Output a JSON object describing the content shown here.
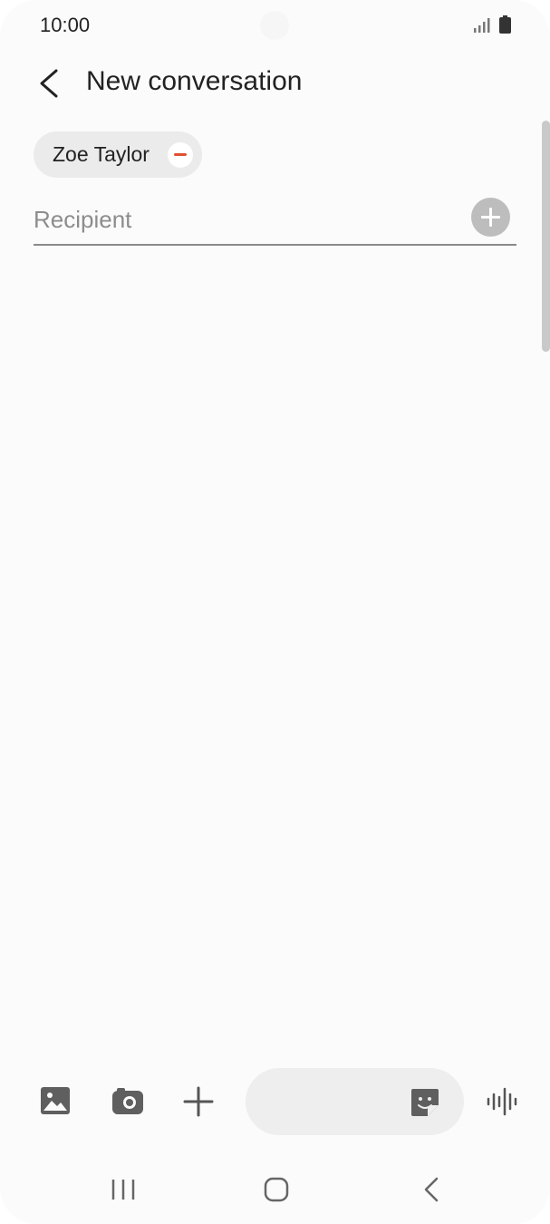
{
  "status_bar": {
    "time": "10:00",
    "signal_icon": "signal-icon",
    "battery_icon": "battery-icon"
  },
  "header": {
    "back_icon": "chevron-left-icon",
    "title": "New conversation"
  },
  "recipients": {
    "chips": [
      {
        "name": "Zoe Taylor",
        "remove_icon": "minus-circle-icon"
      }
    ],
    "input_placeholder": "Recipient",
    "input_value": "",
    "add_icon": "plus-circle-icon"
  },
  "composer": {
    "gallery_icon": "image-icon",
    "camera_icon": "camera-icon",
    "add_icon": "plus-icon",
    "message_value": "",
    "sticker_icon": "sticker-icon",
    "voice_icon": "voice-waveform-icon"
  },
  "navigation": {
    "recent_icon": "recent-apps-icon",
    "home_icon": "home-icon",
    "back_icon": "back-icon"
  },
  "colors": {
    "background": "#fbfbfb",
    "chip_background": "#ebebeb",
    "remove_accent": "#e2502e",
    "icon_gray": "#5f5f5f"
  }
}
